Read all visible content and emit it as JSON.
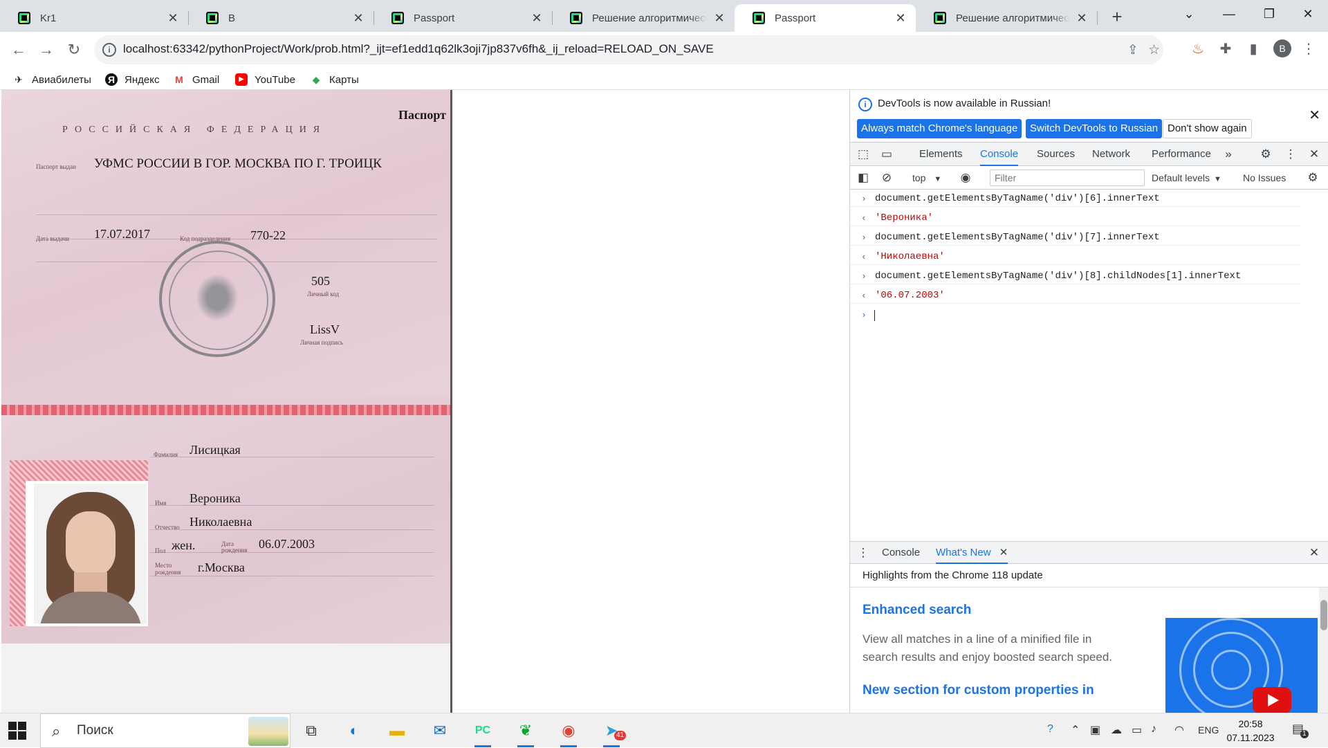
{
  "tabs": [
    {
      "title": "Kr1",
      "active": false
    },
    {
      "title": "B",
      "active": false
    },
    {
      "title": "Passport",
      "active": false
    },
    {
      "title": "Решение алгоритмическо",
      "active": false
    },
    {
      "title": "Passport",
      "active": true
    },
    {
      "title": "Решение алгоритмическо",
      "active": false
    }
  ],
  "toolbar": {
    "url": "localhost:63342/pythonProject/Work/prob.html?_ijt=ef1edd1q62lk3oji7jp837v6fh&_ij_reload=RELOAD_ON_SAVE",
    "profile_initial": "B"
  },
  "bookmarks": [
    {
      "label": "Авиабилеты",
      "icon": "plane-icon"
    },
    {
      "label": "Яндекс",
      "icon": "yandex-icon"
    },
    {
      "label": "Gmail",
      "icon": "gmail-icon"
    },
    {
      "label": "YouTube",
      "icon": "youtube-icon"
    },
    {
      "label": "Карты",
      "icon": "maps-icon"
    }
  ],
  "passport": {
    "heading": "Паспорт",
    "country": "РОССИЙСКАЯ ФЕДЕРАЦИЯ",
    "issued_by_label": "Паспорт выдан",
    "issued_by": "УФМС РОССИИ В ГОР. МОСКВА ПО Г. ТРОИЦК",
    "issue_date_label": "Дата выдачи",
    "issue_date": "17.07.2017",
    "dept_code_label": "Код подразделения",
    "dept_code": "770-22",
    "personal_code": "505",
    "personal_code_label": "Личный код",
    "signature": "LissV",
    "signature_label": "Личная подпись",
    "surname_label": "Фамилия",
    "surname": "Лисицкая",
    "name_label": "Имя",
    "name": "Вероника",
    "patronymic_label": "Отчество",
    "patronymic": "Николаевна",
    "sex_label": "Пол",
    "sex": "жен.",
    "birth_date_label": "Дата рождения",
    "birth_date": "06.07.2003",
    "birth_place_label": "Место рождения",
    "birth_place": "г.Москва"
  },
  "devtools": {
    "info_message": "DevTools is now available in Russian!",
    "btn_match": "Always match Chrome's language",
    "btn_switch": "Switch DevTools to Russian",
    "btn_dont_show": "Don't show again",
    "tabs": [
      "Elements",
      "Console",
      "Sources",
      "Network",
      "Performance"
    ],
    "active_tab": "Console",
    "context": "top",
    "filter_placeholder": "Filter",
    "levels": "Default levels",
    "issues": "No Issues",
    "console": [
      {
        "kind": "input",
        "text": "document.getElementsByTagName('div')[6].innerText"
      },
      {
        "kind": "output",
        "text": "'Вероника'"
      },
      {
        "kind": "input",
        "text": "document.getElementsByTagName('div')[7].innerText"
      },
      {
        "kind": "output",
        "text": "'Николаевна'"
      },
      {
        "kind": "input",
        "text": "document.getElementsByTagName('div')[8].childNodes[1].innerText"
      },
      {
        "kind": "output",
        "text": "'06.07.2003'"
      }
    ],
    "drawer": {
      "tabs": [
        "Console",
        "What's New"
      ],
      "active_tab": "What's New",
      "header": "Highlights from the Chrome 118 update",
      "item1_title": "Enhanced search",
      "item1_text": "View all matches in a line of a minified file in search results and enjoy boosted search speed.",
      "item2_title": "New section for custom properties in"
    }
  },
  "taskbar": {
    "search_label": "Поиск",
    "lang": "ENG",
    "time": "20:58",
    "date": "07.11.2023",
    "telegram_badge": "41",
    "notification_count": "1"
  },
  "colors": {
    "accent": "#1a73e8",
    "console_string": "#c80000",
    "tabstrip": "#dee1e6"
  }
}
